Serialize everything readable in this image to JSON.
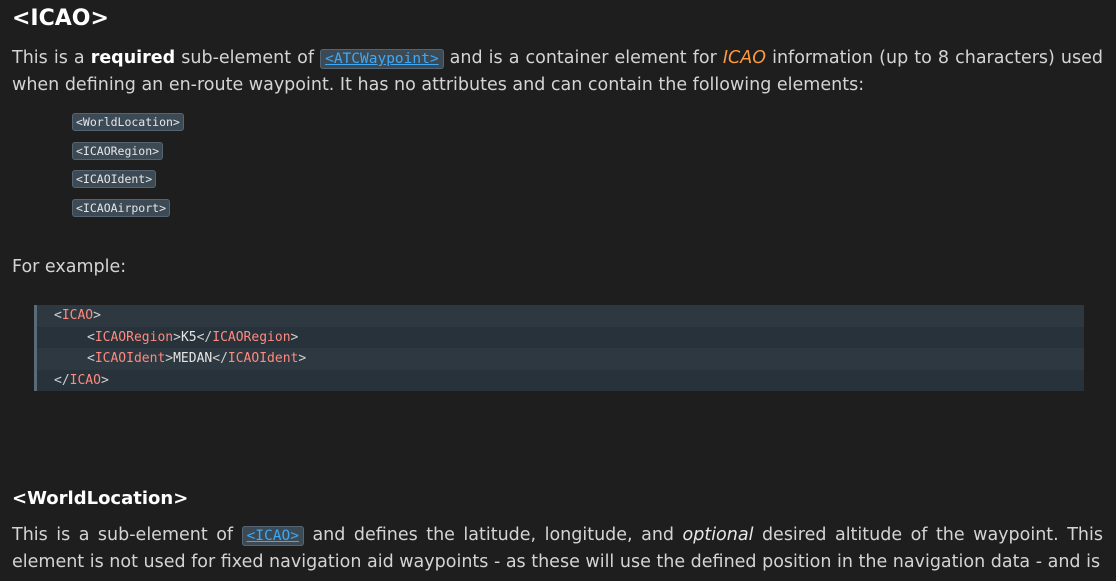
{
  "heading_icao": "<ICAO>",
  "para1": {
    "t1": "This is a ",
    "required": "required",
    "t2": " sub-element of ",
    "link": "<ATCWaypoint>",
    "t3": " and is a container element for ",
    "icao": "ICAO",
    "t4": " information (up to 8 characters) used when defining an en-route waypoint. It has no attributes and can contain the following elements:"
  },
  "elements": [
    "<WorldLocation>",
    "<ICAORegion>",
    "<ICAOIdent>",
    "<ICAOAirport>"
  ],
  "example_label": "For example:",
  "code": {
    "l1_tag": "ICAO",
    "l2_tag": "ICAORegion",
    "l2_val": "K5",
    "l3_tag": "ICAOIdent",
    "l3_val": "MEDAN",
    "l4_tag": "ICAO"
  },
  "heading_world": "<WorldLocation>",
  "para3": {
    "t1": "This is a sub-element of ",
    "link": "<ICAO>",
    "t2": " and defines the latitude, longitude, and ",
    "optional": "optional",
    "t3": " desired altitude of the waypoint. This element is not used for fixed navigation aid waypoints - as these will use the defined position in the navigation data - and is"
  }
}
